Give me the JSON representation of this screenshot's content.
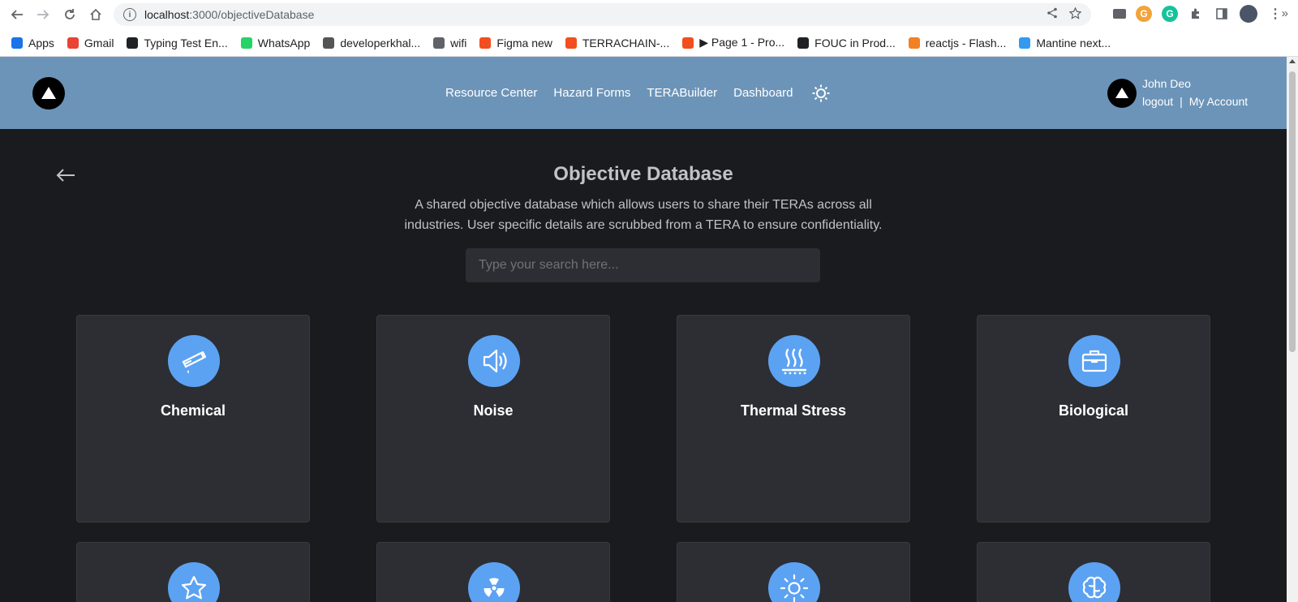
{
  "browser": {
    "url_host": "localhost",
    "url_path": ":3000/objectiveDatabase",
    "bookmarks": [
      {
        "label": "Apps",
        "icon": "apps-grid-icon",
        "color": "#1a73e8"
      },
      {
        "label": "Gmail",
        "icon": "gmail-icon",
        "color": "#ea4335"
      },
      {
        "label": "Typing Test En...",
        "icon": "typing-test-icon",
        "color": "#202124"
      },
      {
        "label": "WhatsApp",
        "icon": "whatsapp-icon",
        "color": "#25d366"
      },
      {
        "label": "developerkhal...",
        "icon": "devkhal-icon",
        "color": "#555555"
      },
      {
        "label": "wifi",
        "icon": "globe-icon",
        "color": "#5f6368"
      },
      {
        "label": "Figma new",
        "icon": "figma-icon",
        "color": "#f24e1e"
      },
      {
        "label": "TERRACHAIN-...",
        "icon": "figma-icon",
        "color": "#f24e1e"
      },
      {
        "label": "▶ Page 1 - Pro...",
        "icon": "figma-icon",
        "color": "#f24e1e"
      },
      {
        "label": "FOUC in Prod...",
        "icon": "github-icon",
        "color": "#202124"
      },
      {
        "label": "reactjs - Flash...",
        "icon": "stackoverflow-icon",
        "color": "#f48024"
      },
      {
        "label": "Mantine next...",
        "icon": "react-icon",
        "color": "#339af0"
      }
    ],
    "more": "»"
  },
  "header": {
    "nav": [
      "Resource Center",
      "Hazard Forms",
      "TERABuilder",
      "Dashboard"
    ],
    "user_name": "John Deo",
    "logout": "logout",
    "separator": "|",
    "account": "My Account"
  },
  "main": {
    "title": "Objective Database",
    "description": "A shared objective database which allows users to share their TERAs across all industries. User specific details are scrubbed from a TERA to ensure confidentiality.",
    "search_placeholder": "Type your search here...",
    "cards": [
      {
        "label": "Chemical",
        "icon": "test-tube-icon"
      },
      {
        "label": "Noise",
        "icon": "speaker-icon"
      },
      {
        "label": "Thermal Stress",
        "icon": "heat-icon"
      },
      {
        "label": "Biological",
        "icon": "briefcase-icon"
      },
      {
        "label": "",
        "icon": "star-icon"
      },
      {
        "label": "",
        "icon": "radiation-icon"
      },
      {
        "label": "",
        "icon": "sun-icon"
      },
      {
        "label": "",
        "icon": "brain-icon"
      }
    ]
  },
  "colors": {
    "header_bg": "#6c94b8",
    "page_bg": "#1a1b1e",
    "card_bg": "#2c2e33",
    "accent": "#5ca2f2"
  }
}
